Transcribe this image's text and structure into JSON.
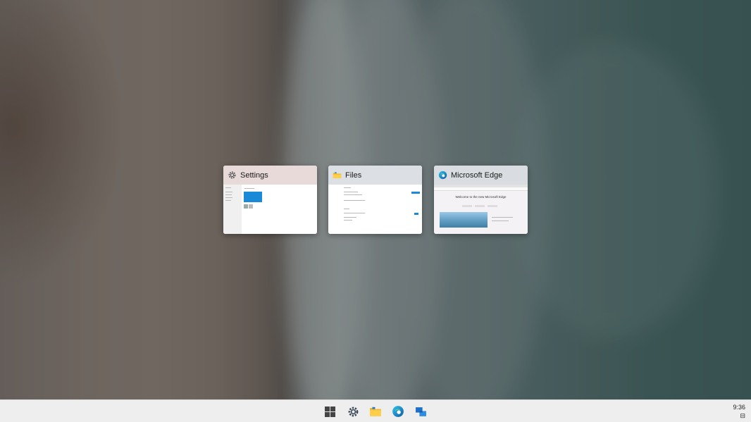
{
  "windows": [
    {
      "id": "settings",
      "title": "Settings",
      "icon": "gear-icon"
    },
    {
      "id": "files",
      "title": "Files",
      "icon": "folder-icon"
    },
    {
      "id": "edge",
      "title": "Microsoft Edge",
      "icon": "edge-icon"
    }
  ],
  "edge_thumb": {
    "heading": "Welcome to the new Microsoft Edge"
  },
  "taskbar": {
    "items": [
      "start-icon",
      "settings-icon",
      "files-icon",
      "edge-icon",
      "task-view-icon"
    ],
    "clock_time": "9:36",
    "tray_glyph": "⊟"
  },
  "colors": {
    "taskbar_bg": "#eeeeee",
    "accent_blue": "#0078d7",
    "folder_yellow": "#f2b829"
  }
}
